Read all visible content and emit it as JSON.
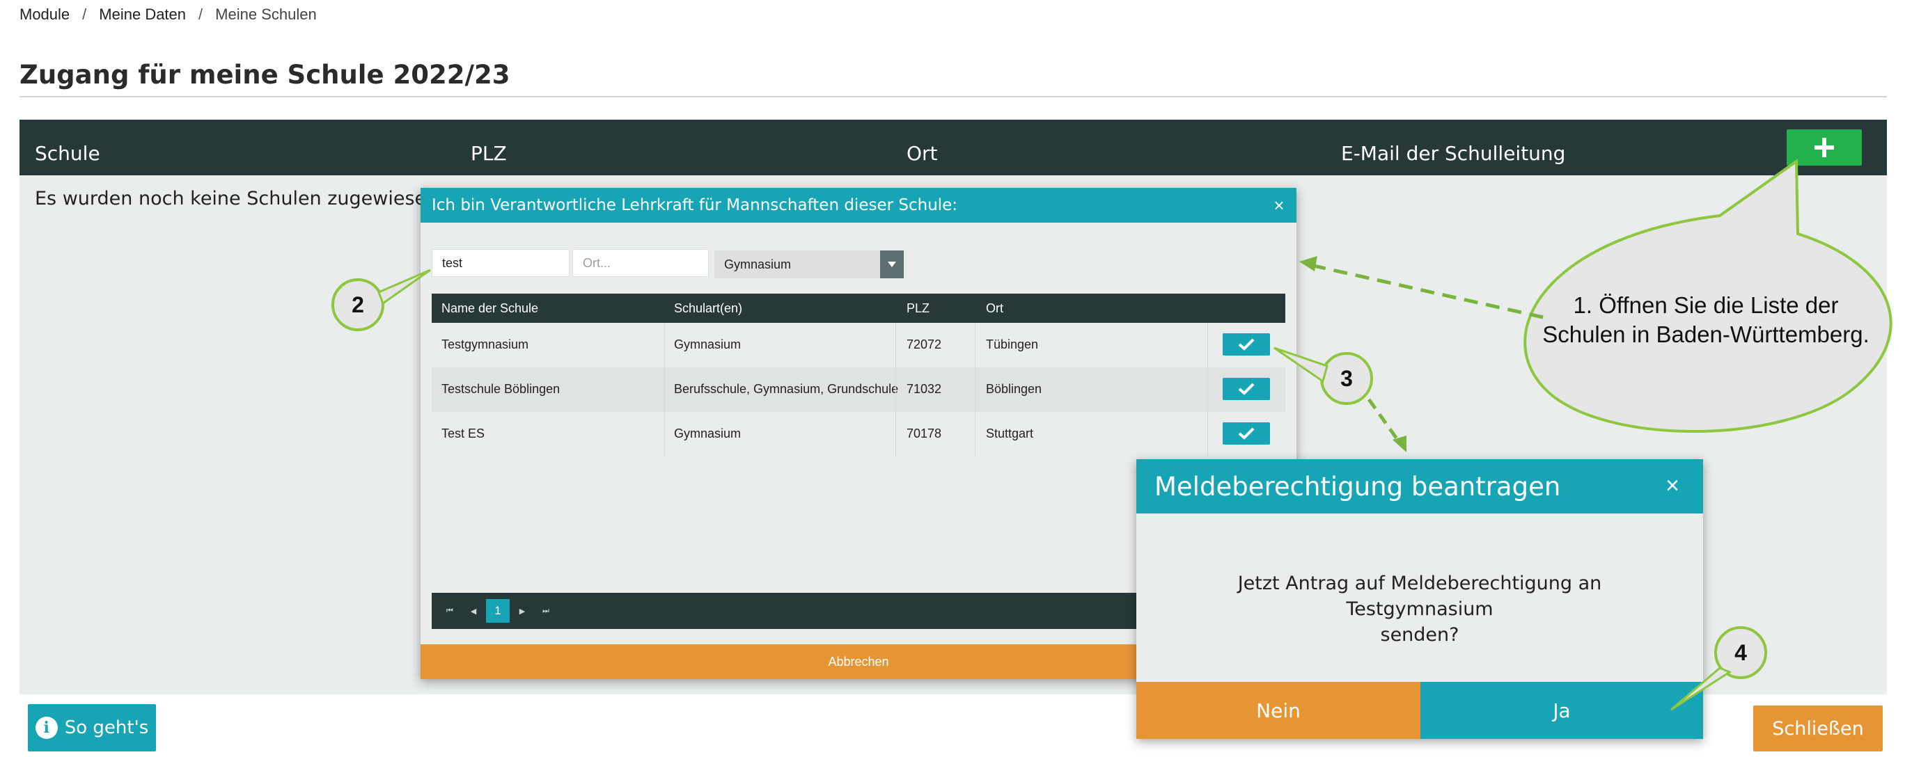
{
  "breadcrumb": {
    "items": [
      "Module",
      "Meine Daten",
      "Meine Schulen"
    ],
    "separator": "/"
  },
  "page": {
    "title": "Zugang für meine Schule 2022/23"
  },
  "schools_table": {
    "columns": [
      "Schule",
      "PLZ",
      "Ort",
      "E-Mail der Schulleitung"
    ],
    "empty_message": "Es wurden noch keine Schulen zugewiesen.",
    "add_icon": "plus-icon"
  },
  "school_dialog": {
    "title": "Ich bin Verantwortliche Lehrkraft für Mannschaften dieser Schule:",
    "close_label": "×",
    "filters": {
      "name_value": "test",
      "ort_placeholder": "Ort...",
      "schulart_selected": "Gymnasium"
    },
    "columns": [
      "Name der Schule",
      "Schulart(en)",
      "PLZ",
      "Ort"
    ],
    "rows": [
      {
        "name": "Testgymnasium",
        "schulart": "Gymnasium",
        "plz": "72072",
        "ort": "Tübingen"
      },
      {
        "name": "Testschule Böblingen",
        "schulart": "Berufsschule, Gymnasium, Grundschule",
        "plz": "71032",
        "ort": "Böblingen"
      },
      {
        "name": "Test ES",
        "schulart": "Gymnasium",
        "plz": "70178",
        "ort": "Stuttgart"
      }
    ],
    "pager": {
      "current_page": "1"
    },
    "cancel_label": "Abbrechen"
  },
  "confirm_dialog": {
    "title": "Meldeberechtigung beantragen",
    "close_label": "×",
    "message_line1": "Jetzt Antrag auf Meldeberechtigung an Testgymnasium",
    "message_line2": "senden?",
    "no_label": "Nein",
    "yes_label": "Ja"
  },
  "footer": {
    "howto_label": "So geht's",
    "howto_icon": "info-icon",
    "close_label": "Schließen"
  },
  "annotations": {
    "callout_line1": "1. Öffnen Sie die Liste der",
    "callout_line2": "Schulen in Baden-Württemberg.",
    "badges": [
      "2",
      "3",
      "4"
    ]
  },
  "colors": {
    "dark_header": "#263838",
    "teal": "#17a5b5",
    "orange": "#e69535",
    "green": "#22b14c",
    "panel_bg": "#e9edec",
    "annotation_green": "#8ec63f",
    "callout_fill": "#e6e6e6"
  }
}
